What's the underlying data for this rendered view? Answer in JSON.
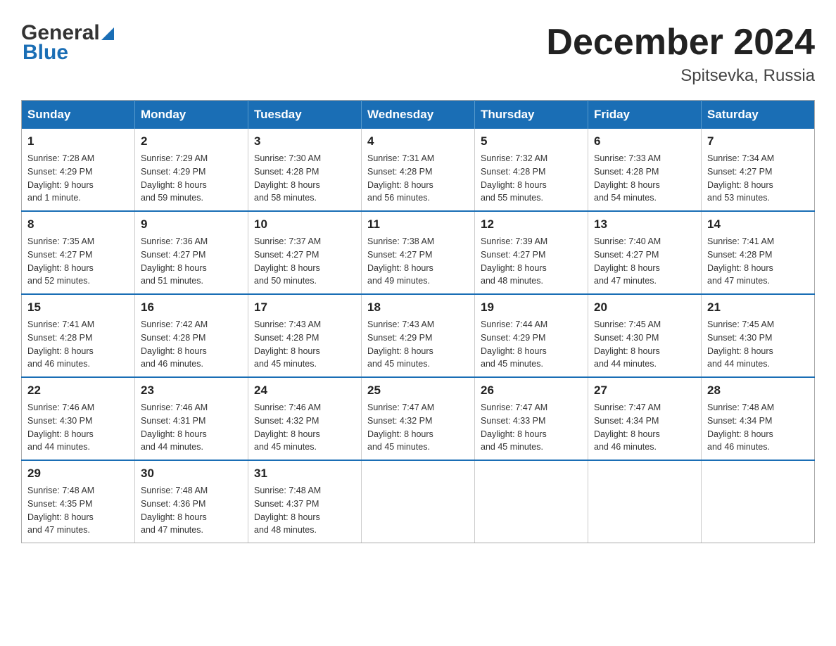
{
  "header": {
    "logo_general": "General",
    "logo_blue": "Blue",
    "month_title": "December 2024",
    "location": "Spitsevka, Russia"
  },
  "weekdays": [
    "Sunday",
    "Monday",
    "Tuesday",
    "Wednesday",
    "Thursday",
    "Friday",
    "Saturday"
  ],
  "weeks": [
    [
      {
        "day": "1",
        "sunrise": "7:28 AM",
        "sunset": "4:29 PM",
        "daylight": "9 hours and 1 minute."
      },
      {
        "day": "2",
        "sunrise": "7:29 AM",
        "sunset": "4:29 PM",
        "daylight": "8 hours and 59 minutes."
      },
      {
        "day": "3",
        "sunrise": "7:30 AM",
        "sunset": "4:28 PM",
        "daylight": "8 hours and 58 minutes."
      },
      {
        "day": "4",
        "sunrise": "7:31 AM",
        "sunset": "4:28 PM",
        "daylight": "8 hours and 56 minutes."
      },
      {
        "day": "5",
        "sunrise": "7:32 AM",
        "sunset": "4:28 PM",
        "daylight": "8 hours and 55 minutes."
      },
      {
        "day": "6",
        "sunrise": "7:33 AM",
        "sunset": "4:28 PM",
        "daylight": "8 hours and 54 minutes."
      },
      {
        "day": "7",
        "sunrise": "7:34 AM",
        "sunset": "4:27 PM",
        "daylight": "8 hours and 53 minutes."
      }
    ],
    [
      {
        "day": "8",
        "sunrise": "7:35 AM",
        "sunset": "4:27 PM",
        "daylight": "8 hours and 52 minutes."
      },
      {
        "day": "9",
        "sunrise": "7:36 AM",
        "sunset": "4:27 PM",
        "daylight": "8 hours and 51 minutes."
      },
      {
        "day": "10",
        "sunrise": "7:37 AM",
        "sunset": "4:27 PM",
        "daylight": "8 hours and 50 minutes."
      },
      {
        "day": "11",
        "sunrise": "7:38 AM",
        "sunset": "4:27 PM",
        "daylight": "8 hours and 49 minutes."
      },
      {
        "day": "12",
        "sunrise": "7:39 AM",
        "sunset": "4:27 PM",
        "daylight": "8 hours and 48 minutes."
      },
      {
        "day": "13",
        "sunrise": "7:40 AM",
        "sunset": "4:27 PM",
        "daylight": "8 hours and 47 minutes."
      },
      {
        "day": "14",
        "sunrise": "7:41 AM",
        "sunset": "4:28 PM",
        "daylight": "8 hours and 47 minutes."
      }
    ],
    [
      {
        "day": "15",
        "sunrise": "7:41 AM",
        "sunset": "4:28 PM",
        "daylight": "8 hours and 46 minutes."
      },
      {
        "day": "16",
        "sunrise": "7:42 AM",
        "sunset": "4:28 PM",
        "daylight": "8 hours and 46 minutes."
      },
      {
        "day": "17",
        "sunrise": "7:43 AM",
        "sunset": "4:28 PM",
        "daylight": "8 hours and 45 minutes."
      },
      {
        "day": "18",
        "sunrise": "7:43 AM",
        "sunset": "4:29 PM",
        "daylight": "8 hours and 45 minutes."
      },
      {
        "day": "19",
        "sunrise": "7:44 AM",
        "sunset": "4:29 PM",
        "daylight": "8 hours and 45 minutes."
      },
      {
        "day": "20",
        "sunrise": "7:45 AM",
        "sunset": "4:30 PM",
        "daylight": "8 hours and 44 minutes."
      },
      {
        "day": "21",
        "sunrise": "7:45 AM",
        "sunset": "4:30 PM",
        "daylight": "8 hours and 44 minutes."
      }
    ],
    [
      {
        "day": "22",
        "sunrise": "7:46 AM",
        "sunset": "4:30 PM",
        "daylight": "8 hours and 44 minutes."
      },
      {
        "day": "23",
        "sunrise": "7:46 AM",
        "sunset": "4:31 PM",
        "daylight": "8 hours and 44 minutes."
      },
      {
        "day": "24",
        "sunrise": "7:46 AM",
        "sunset": "4:32 PM",
        "daylight": "8 hours and 45 minutes."
      },
      {
        "day": "25",
        "sunrise": "7:47 AM",
        "sunset": "4:32 PM",
        "daylight": "8 hours and 45 minutes."
      },
      {
        "day": "26",
        "sunrise": "7:47 AM",
        "sunset": "4:33 PM",
        "daylight": "8 hours and 45 minutes."
      },
      {
        "day": "27",
        "sunrise": "7:47 AM",
        "sunset": "4:34 PM",
        "daylight": "8 hours and 46 minutes."
      },
      {
        "day": "28",
        "sunrise": "7:48 AM",
        "sunset": "4:34 PM",
        "daylight": "8 hours and 46 minutes."
      }
    ],
    [
      {
        "day": "29",
        "sunrise": "7:48 AM",
        "sunset": "4:35 PM",
        "daylight": "8 hours and 47 minutes."
      },
      {
        "day": "30",
        "sunrise": "7:48 AM",
        "sunset": "4:36 PM",
        "daylight": "8 hours and 47 minutes."
      },
      {
        "day": "31",
        "sunrise": "7:48 AM",
        "sunset": "4:37 PM",
        "daylight": "8 hours and 48 minutes."
      },
      null,
      null,
      null,
      null
    ]
  ]
}
